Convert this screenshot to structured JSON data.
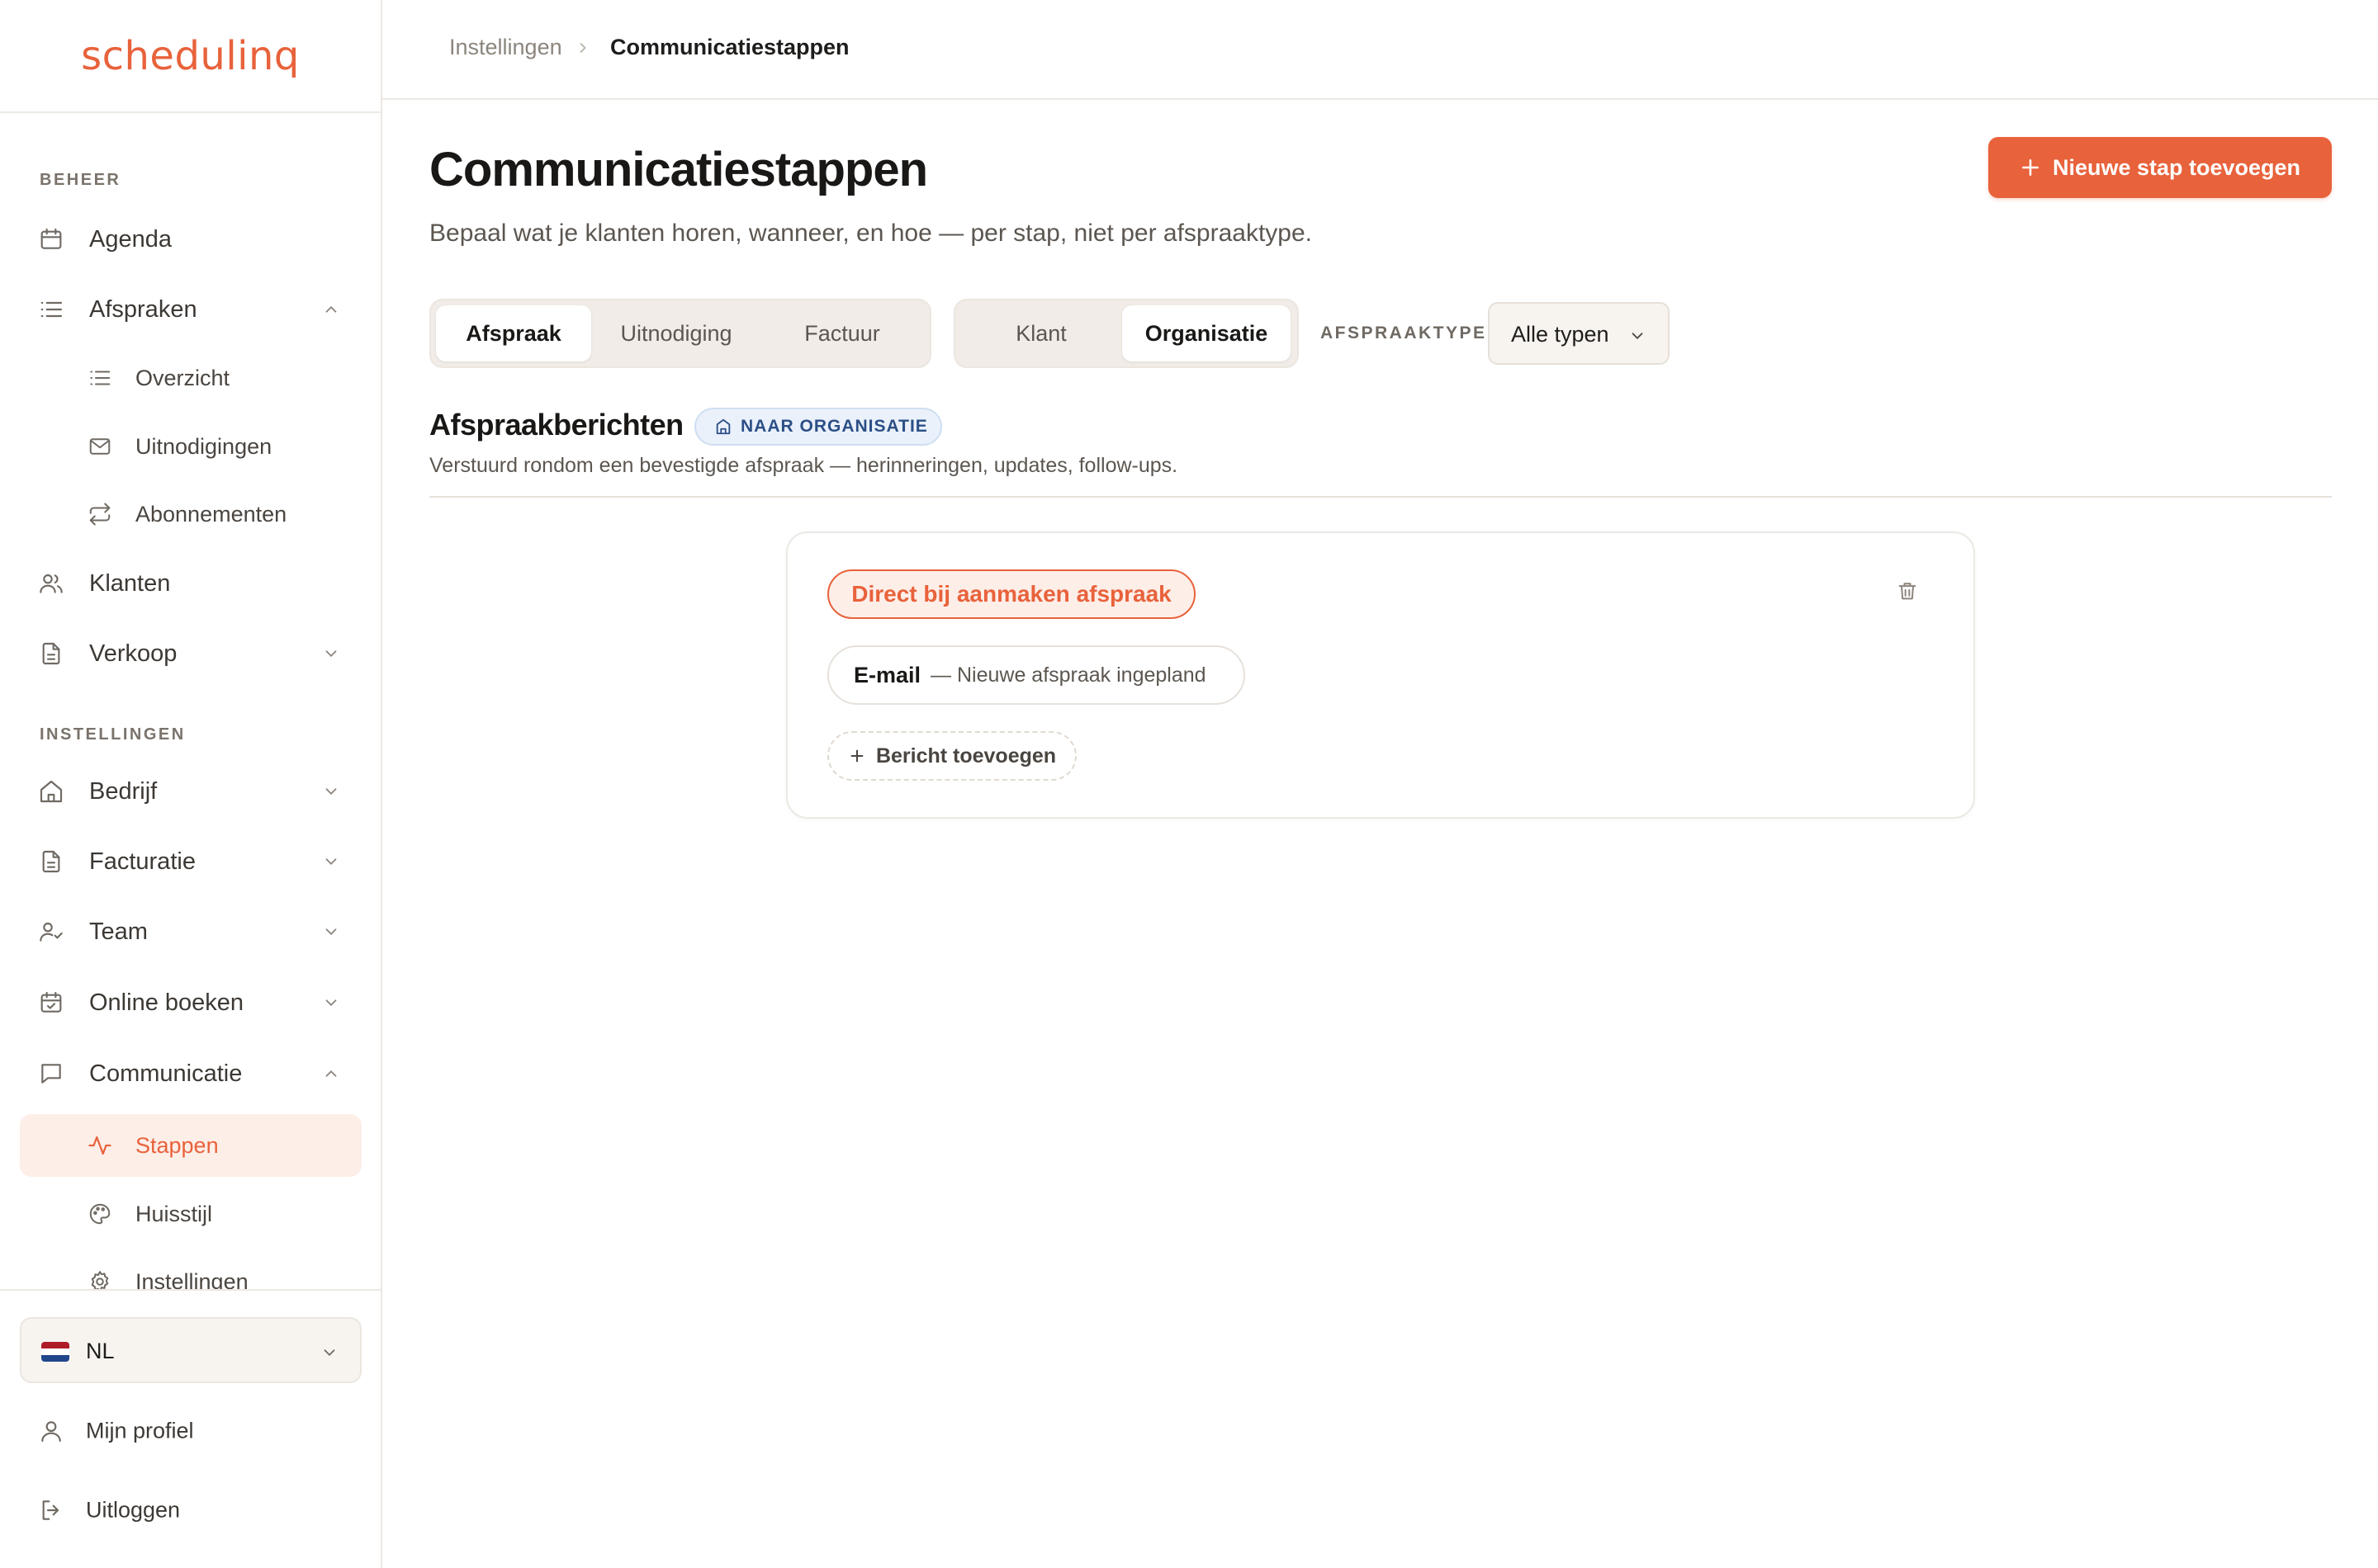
{
  "app": {
    "logo_text": "schedulinq",
    "accent_color": "#e8623b"
  },
  "breadcrumb": {
    "parent": "Instellingen",
    "current": "Communicatiestappen"
  },
  "sidebar": {
    "section_beheer": "BEHEER",
    "section_instellingen": "INSTELLINGEN",
    "items": [
      {
        "label": "Agenda",
        "icon": "calendar-icon"
      },
      {
        "label": "Afspraken",
        "icon": "list-icon",
        "expanded": true
      },
      {
        "label": "Overzicht",
        "icon": "list-icon"
      },
      {
        "label": "Uitnodigingen",
        "icon": "mail-icon"
      },
      {
        "label": "Abonnementen",
        "icon": "repeat-icon"
      },
      {
        "label": "Klanten",
        "icon": "users-icon"
      },
      {
        "label": "Verkoop",
        "icon": "document-icon",
        "expanded": false
      },
      {
        "label": "Bedrijf",
        "icon": "home-icon",
        "expanded": false
      },
      {
        "label": "Facturatie",
        "icon": "document-icon",
        "expanded": false
      },
      {
        "label": "Team",
        "icon": "user-check-icon",
        "expanded": false
      },
      {
        "label": "Online boeken",
        "icon": "calendar-check-icon",
        "expanded": false
      },
      {
        "label": "Communicatie",
        "icon": "message-icon",
        "expanded": true
      },
      {
        "label": "Stappen",
        "icon": "activity-icon",
        "active": true
      },
      {
        "label": "Huisstijl",
        "icon": "palette-icon"
      },
      {
        "label": "Instellingen",
        "icon": "gear-icon"
      }
    ],
    "language": {
      "code": "NL",
      "flag_colors": [
        "#ae1c28",
        "#ffffff",
        "#21468b"
      ]
    },
    "profile_label": "Mijn profiel",
    "logout_label": "Uitloggen"
  },
  "page": {
    "title": "Communicatiestappen",
    "subtitle": "Bepaal wat je klanten horen, wanneer, en hoe — per stap, niet per afspraaktype.",
    "add_button_label": "Nieuwe stap toevoegen"
  },
  "filters": {
    "category_tabs": [
      {
        "label": "Afspraak",
        "selected": true
      },
      {
        "label": "Uitnodiging",
        "selected": false
      },
      {
        "label": "Factuur",
        "selected": false
      }
    ],
    "audience_tabs": [
      {
        "label": "Klant",
        "selected": false
      },
      {
        "label": "Organisatie",
        "selected": true
      }
    ],
    "type_label": "AFSPRAAKTYPE",
    "type_value": "Alle typen"
  },
  "section": {
    "title": "Afspraakberichten",
    "badge": "NAAR ORGANISATIE",
    "description": "Verstuurd rondom een bevestigde afspraak — herinneringen, updates, follow-ups."
  },
  "steps": [
    {
      "trigger": "Direct bij aanmaken afspraak",
      "messages": [
        {
          "channel": "E-mail",
          "description": "— Nieuwe afspraak ingepland"
        }
      ],
      "add_message_label": "Bericht toevoegen"
    }
  ]
}
